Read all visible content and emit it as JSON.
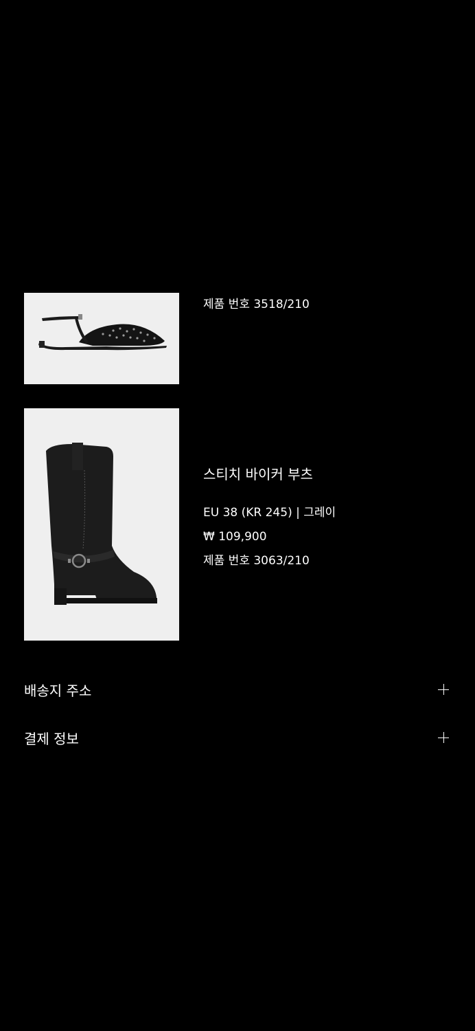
{
  "items": [
    {
      "image_icon": "slingback-flat-shoe-image",
      "product_number": "제품 번호 3518/210"
    },
    {
      "image_icon": "biker-boot-image",
      "name": "스티치 바이커 부츠",
      "variant": "EU 38 (KR 245) | 그레이",
      "price": "₩ 109,900",
      "product_number": "제품 번호 3063/210"
    }
  ],
  "sections": {
    "shipping_address": "배송지 주소",
    "payment_info": "결제 정보"
  },
  "colors": {
    "background": "#000000",
    "text": "#ffffff",
    "image_background": "#efefef"
  }
}
